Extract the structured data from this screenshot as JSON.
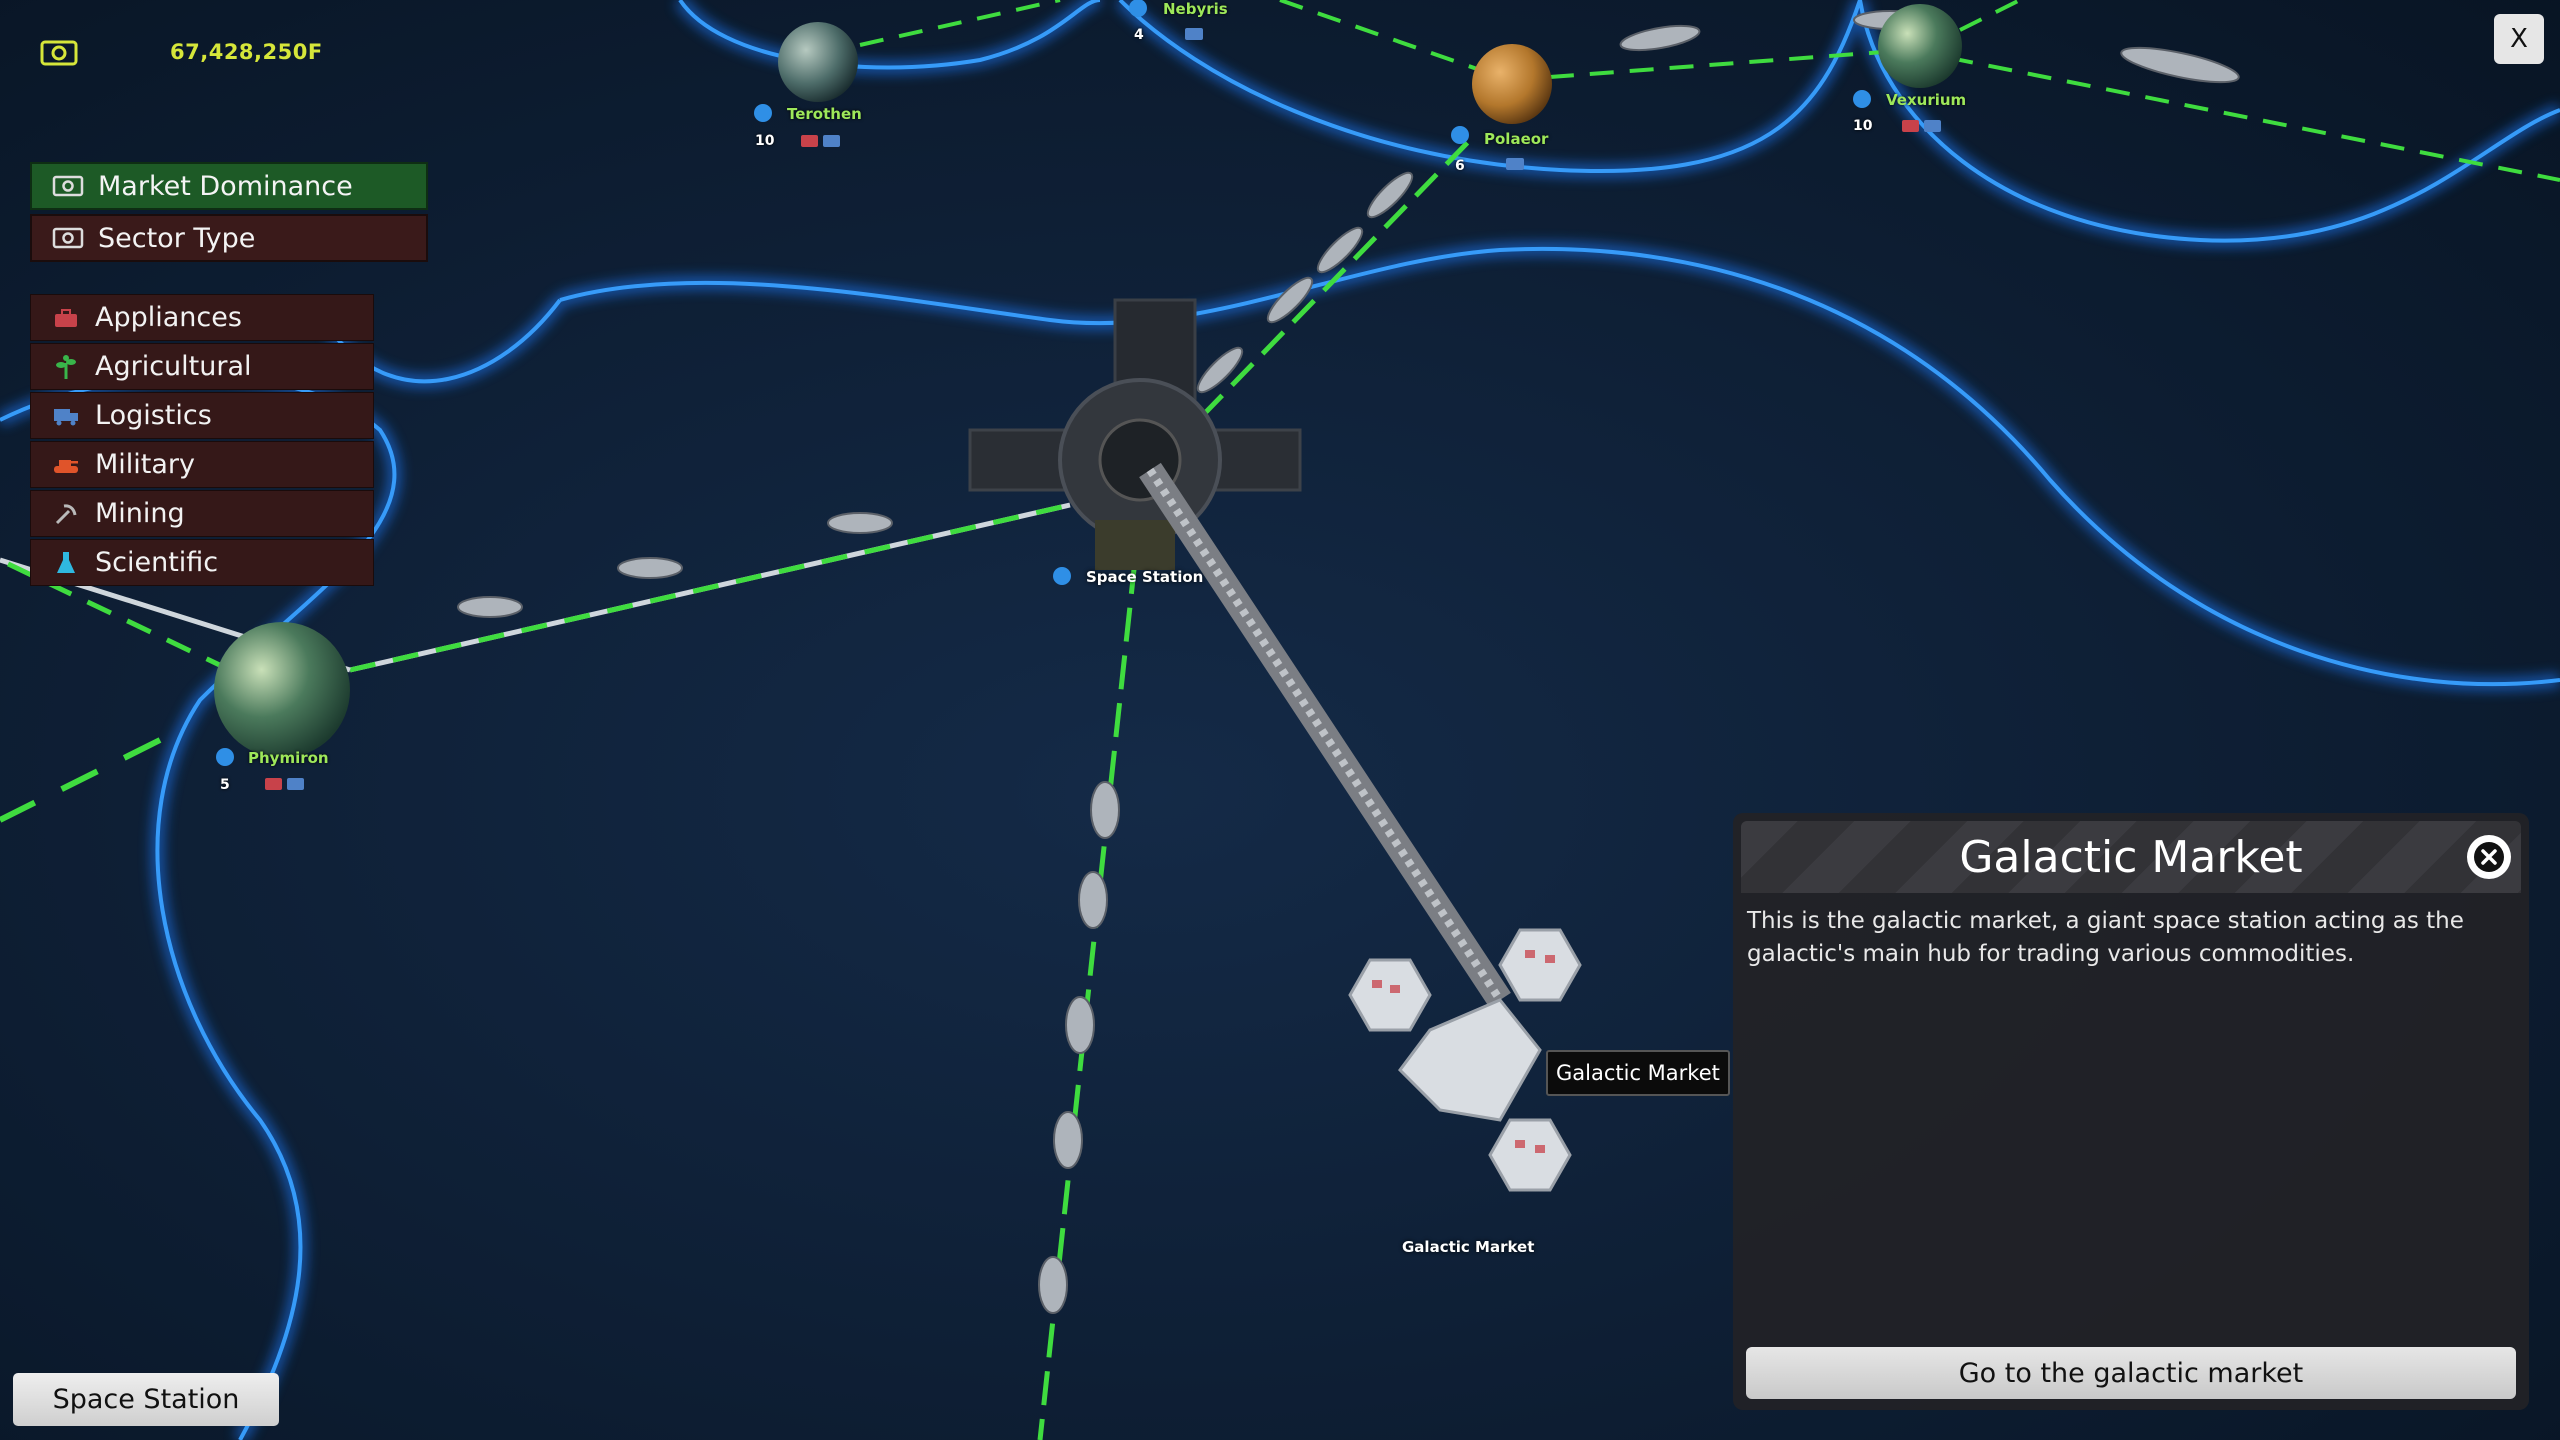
{
  "currency": {
    "value": "67,428,250F"
  },
  "map_modes": [
    {
      "label": "Market Dominance",
      "active": true
    },
    {
      "label": "Sector Type",
      "active": false
    }
  ],
  "legend": [
    {
      "label": "Appliances",
      "icon": "toolbox-icon",
      "color": "#c8424a"
    },
    {
      "label": "Agricultural",
      "icon": "plant-icon",
      "color": "#39b54a"
    },
    {
      "label": "Logistics",
      "icon": "truck-icon",
      "color": "#4f82c8"
    },
    {
      "label": "Military",
      "icon": "tank-icon",
      "color": "#e0542a"
    },
    {
      "label": "Mining",
      "icon": "pickaxe-icon",
      "color": "#b9b9b9"
    },
    {
      "label": "Scientific",
      "icon": "flask-icon",
      "color": "#2fb8e0"
    }
  ],
  "close_label": "X",
  "planets": [
    {
      "name": "Nebyris",
      "count": "4"
    },
    {
      "name": "Terothen",
      "count": "10"
    },
    {
      "name": "Polaeor",
      "count": "6"
    },
    {
      "name": "Vexurium",
      "count": "10"
    },
    {
      "name": "Phymiron",
      "count": "5"
    }
  ],
  "space_station_label": "Space Station",
  "galactic_market_label": "Galactic Market",
  "tooltip": "Galactic Market",
  "panel": {
    "title": "Galactic Market",
    "description": "This is the galactic market, a giant space station acting as the galactic's main hub for trading various commodities.",
    "button": "Go to the galactic market"
  },
  "bottom_button": "Space Station",
  "colors": {
    "trade_route": "#3fdc3f",
    "border_glow": "#1f7dff",
    "active_mode": "#1d5a26",
    "money": "#d6e63a"
  }
}
